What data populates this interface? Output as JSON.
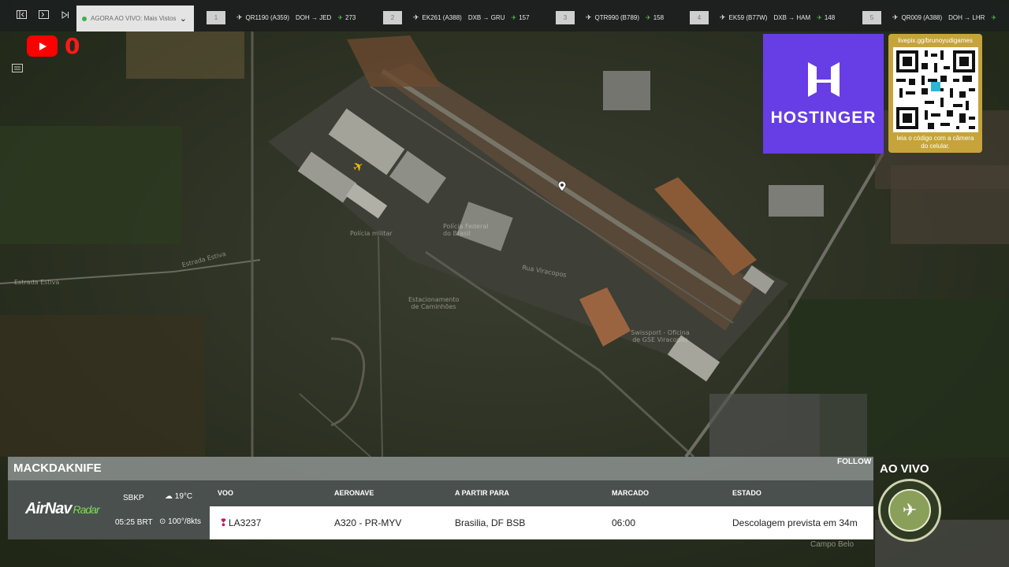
{
  "topbar": {
    "now_label": "AGORA AO VIVO: Mais Vistos",
    "tickers": [
      {
        "num": "1",
        "flight": "QR1190 (A359)",
        "route": "DOH → JED",
        "count": "273"
      },
      {
        "num": "2",
        "flight": "EK261 (A388)",
        "route": "DXB → GRU",
        "count": "157"
      },
      {
        "num": "3",
        "flight": "QTR990 (B789)",
        "route": "",
        "count": "158"
      },
      {
        "num": "4",
        "flight": "EK59 (B77W)",
        "route": "DXB → HAM",
        "count": "148"
      },
      {
        "num": "5",
        "flight": "QR009 (A388)",
        "route": "DOH → LHR",
        "count": ""
      }
    ]
  },
  "youtube": {
    "count": "0"
  },
  "sponsor": {
    "brand": "HOSTINGER",
    "url": "livepix.gg/brunoyudigames",
    "caption": "leia o código com a câmera do celular."
  },
  "map": {
    "labels": [
      "Estrada Estiva",
      "Estrada Estiva",
      "Polícia Federal do Brasil",
      "Polícia militar",
      "Estacionamento de Caminhões",
      "Rua Viracopos",
      "Swissport - Oficina de GSE Viracopos",
      "Campo Belo"
    ]
  },
  "panel": {
    "username": "MACKDAKNIFE",
    "follow": "FOLLOW",
    "logo_main": "AirNav",
    "logo_sub": "Radar",
    "airport": "SBKP",
    "temperature": "19°C",
    "time": "05:25 BRT",
    "wind": "100°/8kts",
    "headers": [
      "VOO",
      "AERONAVE",
      "A PARTIR PARA",
      "MARCADO",
      "ESTADO"
    ],
    "row": {
      "flight": "LA3237",
      "aircraft": "A320 - PR-MYV",
      "destination": "Brasilia, DF BSB",
      "scheduled": "06:00",
      "status": "Descolagem prevista em 34m"
    }
  },
  "live": {
    "label": "AO VIVO"
  }
}
